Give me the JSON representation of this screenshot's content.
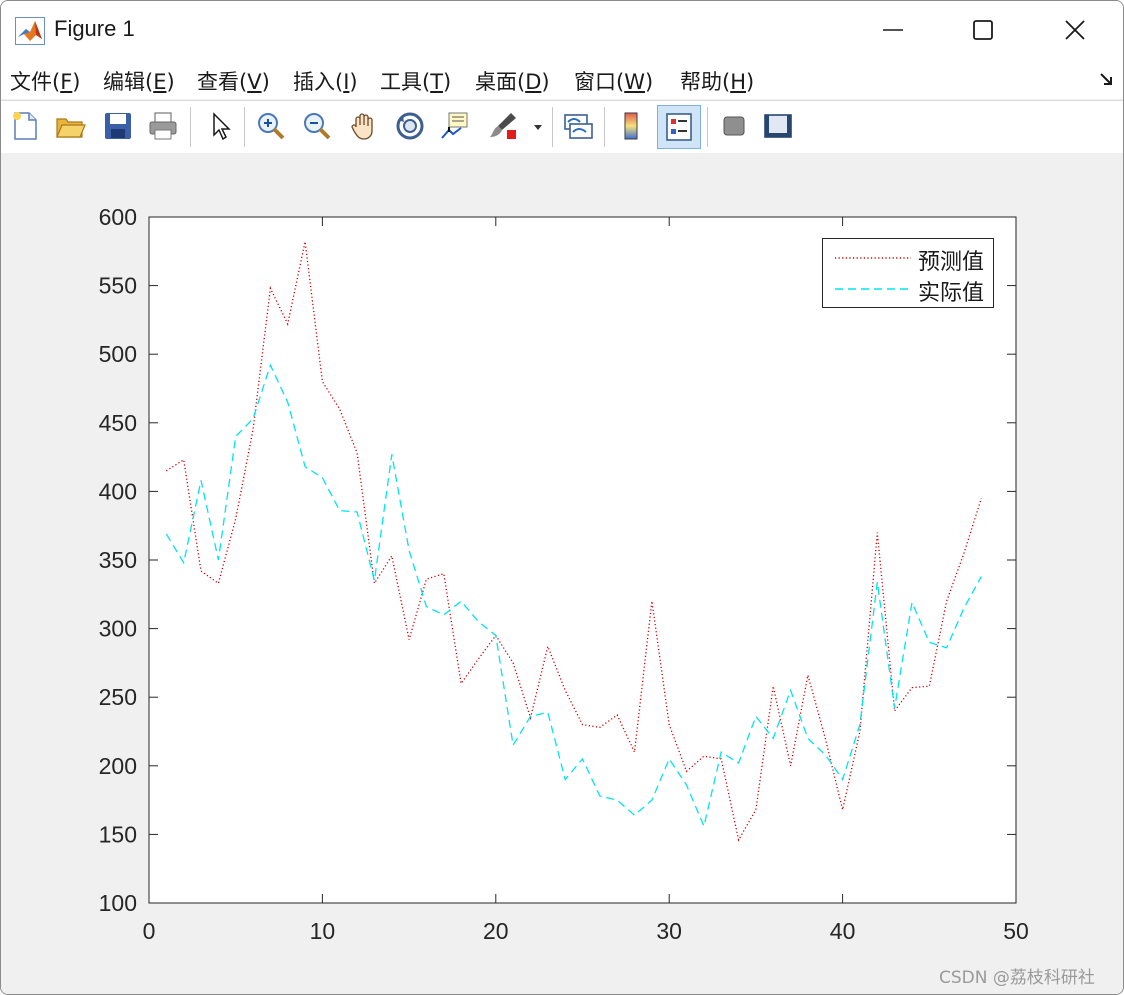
{
  "window": {
    "title": "Figure 1",
    "app_icon": "matlab-icon",
    "controls": [
      "minimize-icon",
      "maximize-icon",
      "close-icon"
    ]
  },
  "menubar": {
    "items": [
      {
        "pre": "文件(",
        "mn": "F",
        "post": ")"
      },
      {
        "pre": "编辑(",
        "mn": "E",
        "post": ")"
      },
      {
        "pre": "查看(",
        "mn": "V",
        "post": ")"
      },
      {
        "pre": "插入(",
        "mn": "I",
        "post": ")"
      },
      {
        "pre": "工具(",
        "mn": "T",
        "post": ")"
      },
      {
        "pre": "桌面(",
        "mn": "D",
        "post": ")"
      },
      {
        "pre": "窗口(",
        "mn": "W",
        "post": ")"
      },
      {
        "pre": "帮助(",
        "mn": "H",
        "post": ")"
      }
    ],
    "dock_icon": "dock-arrow-icon"
  },
  "toolbar": {
    "buttons": [
      "new-figure-icon",
      "open-file-icon",
      "save-icon",
      "print-icon",
      "edit-plot-pointer-icon",
      "zoom-in-icon",
      "zoom-out-icon",
      "pan-hand-icon",
      "rotate-3d-icon",
      "data-cursor-icon",
      "brush-icon",
      "link-plot-icon",
      "colorbar-icon",
      "legend-icon",
      "hide-plot-tools-icon",
      "show-plot-tools-icon"
    ],
    "active": "legend-icon"
  },
  "watermark": "CSDN @荔枝科研社",
  "chart_data": {
    "type": "line",
    "title": "",
    "xlabel": "",
    "ylabel": "",
    "xlim": [
      0,
      50
    ],
    "ylim": [
      100,
      600
    ],
    "xticks": [
      0,
      10,
      20,
      30,
      40,
      50
    ],
    "yticks": [
      100,
      150,
      200,
      250,
      300,
      350,
      400,
      450,
      500,
      550,
      600
    ],
    "grid": false,
    "legend_position": "top-right",
    "x": [
      1,
      2,
      3,
      4,
      5,
      6,
      7,
      8,
      9,
      10,
      11,
      12,
      13,
      14,
      15,
      16,
      17,
      18,
      19,
      20,
      21,
      22,
      23,
      24,
      25,
      26,
      27,
      28,
      29,
      30,
      31,
      32,
      33,
      34,
      35,
      36,
      37,
      38,
      39,
      40,
      41,
      42,
      43,
      44,
      45,
      46,
      47,
      48
    ],
    "series": [
      {
        "name": "预测值",
        "color": "#cc0000",
        "style": "dotted",
        "values": [
          415,
          423,
          342,
          333,
          380,
          445,
          548,
          522,
          582,
          480,
          460,
          428,
          333,
          353,
          292,
          336,
          340,
          260,
          278,
          295,
          275,
          235,
          287,
          255,
          230,
          228,
          237,
          210,
          320,
          230,
          196,
          207,
          205,
          146,
          168,
          258,
          200,
          266,
          220,
          168,
          225,
          370,
          240,
          257,
          258,
          320,
          355,
          395
        ]
      },
      {
        "name": "实际值",
        "color": "#00e5ee",
        "style": "dashed",
        "values": [
          369,
          348,
          408,
          350,
          440,
          453,
          492,
          465,
          418,
          410,
          386,
          385,
          335,
          427,
          357,
          316,
          310,
          320,
          305,
          295,
          215,
          236,
          239,
          190,
          205,
          178,
          175,
          164,
          175,
          205,
          186,
          156,
          210,
          202,
          236,
          220,
          255,
          220,
          208,
          190,
          230,
          334,
          242,
          319,
          290,
          286,
          315,
          338
        ]
      }
    ]
  }
}
